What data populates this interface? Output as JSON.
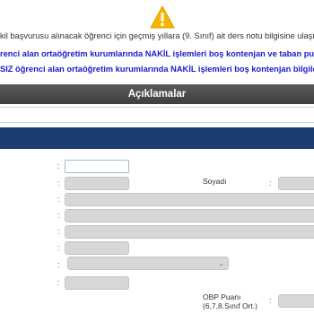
{
  "notice": {
    "line1": "kil başvurusu alınacak öğrenci için geçmiş yıllara (9. Sınıf) ait ders notu bilgisine ulaşıl",
    "line2": "renci alan ortaöğretim kurumlarında NAKİL işlemleri boş kontenjan ve taban puan bilgile",
    "line3": "SIZ öğrenci alan ortaöğretim kurumlarında NAKİL işlemleri boş kontenjan bilgileri için"
  },
  "section": {
    "title": "Açıklamalar"
  },
  "form": {
    "surname_label": "Soyadı",
    "obp_label_line1": "OBP Puanı",
    "obp_label_line2": "(6,7,8.Sınıf Ort.)",
    "colon": ":"
  },
  "icons": {
    "warning": "warning-triangle-icon",
    "dropdown": "chevron-down-icon"
  },
  "colors": {
    "warning": "#f7b500",
    "notice_blue": "#1a1acc",
    "header": "#1c3d72",
    "section_bar": "#4a4a4a"
  }
}
